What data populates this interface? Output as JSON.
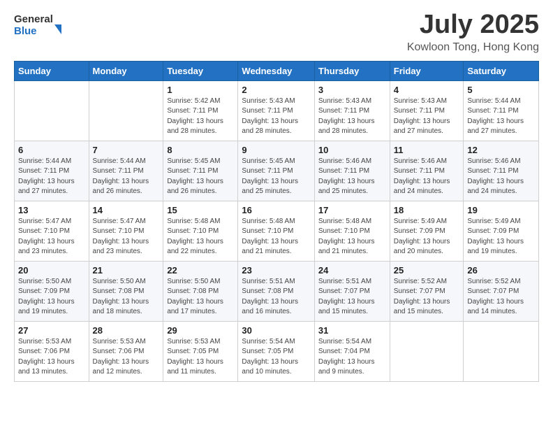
{
  "header": {
    "logo_line1": "General",
    "logo_line2": "Blue",
    "month": "July 2025",
    "location": "Kowloon Tong, Hong Kong"
  },
  "days_of_week": [
    "Sunday",
    "Monday",
    "Tuesday",
    "Wednesday",
    "Thursday",
    "Friday",
    "Saturday"
  ],
  "weeks": [
    [
      {
        "day": "",
        "sunrise": "",
        "sunset": "",
        "daylight": ""
      },
      {
        "day": "",
        "sunrise": "",
        "sunset": "",
        "daylight": ""
      },
      {
        "day": "1",
        "sunrise": "Sunrise: 5:42 AM",
        "sunset": "Sunset: 7:11 PM",
        "daylight": "Daylight: 13 hours and 28 minutes."
      },
      {
        "day": "2",
        "sunrise": "Sunrise: 5:43 AM",
        "sunset": "Sunset: 7:11 PM",
        "daylight": "Daylight: 13 hours and 28 minutes."
      },
      {
        "day": "3",
        "sunrise": "Sunrise: 5:43 AM",
        "sunset": "Sunset: 7:11 PM",
        "daylight": "Daylight: 13 hours and 28 minutes."
      },
      {
        "day": "4",
        "sunrise": "Sunrise: 5:43 AM",
        "sunset": "Sunset: 7:11 PM",
        "daylight": "Daylight: 13 hours and 27 minutes."
      },
      {
        "day": "5",
        "sunrise": "Sunrise: 5:44 AM",
        "sunset": "Sunset: 7:11 PM",
        "daylight": "Daylight: 13 hours and 27 minutes."
      }
    ],
    [
      {
        "day": "6",
        "sunrise": "Sunrise: 5:44 AM",
        "sunset": "Sunset: 7:11 PM",
        "daylight": "Daylight: 13 hours and 27 minutes."
      },
      {
        "day": "7",
        "sunrise": "Sunrise: 5:44 AM",
        "sunset": "Sunset: 7:11 PM",
        "daylight": "Daylight: 13 hours and 26 minutes."
      },
      {
        "day": "8",
        "sunrise": "Sunrise: 5:45 AM",
        "sunset": "Sunset: 7:11 PM",
        "daylight": "Daylight: 13 hours and 26 minutes."
      },
      {
        "day": "9",
        "sunrise": "Sunrise: 5:45 AM",
        "sunset": "Sunset: 7:11 PM",
        "daylight": "Daylight: 13 hours and 25 minutes."
      },
      {
        "day": "10",
        "sunrise": "Sunrise: 5:46 AM",
        "sunset": "Sunset: 7:11 PM",
        "daylight": "Daylight: 13 hours and 25 minutes."
      },
      {
        "day": "11",
        "sunrise": "Sunrise: 5:46 AM",
        "sunset": "Sunset: 7:11 PM",
        "daylight": "Daylight: 13 hours and 24 minutes."
      },
      {
        "day": "12",
        "sunrise": "Sunrise: 5:46 AM",
        "sunset": "Sunset: 7:11 PM",
        "daylight": "Daylight: 13 hours and 24 minutes."
      }
    ],
    [
      {
        "day": "13",
        "sunrise": "Sunrise: 5:47 AM",
        "sunset": "Sunset: 7:10 PM",
        "daylight": "Daylight: 13 hours and 23 minutes."
      },
      {
        "day": "14",
        "sunrise": "Sunrise: 5:47 AM",
        "sunset": "Sunset: 7:10 PM",
        "daylight": "Daylight: 13 hours and 23 minutes."
      },
      {
        "day": "15",
        "sunrise": "Sunrise: 5:48 AM",
        "sunset": "Sunset: 7:10 PM",
        "daylight": "Daylight: 13 hours and 22 minutes."
      },
      {
        "day": "16",
        "sunrise": "Sunrise: 5:48 AM",
        "sunset": "Sunset: 7:10 PM",
        "daylight": "Daylight: 13 hours and 21 minutes."
      },
      {
        "day": "17",
        "sunrise": "Sunrise: 5:48 AM",
        "sunset": "Sunset: 7:10 PM",
        "daylight": "Daylight: 13 hours and 21 minutes."
      },
      {
        "day": "18",
        "sunrise": "Sunrise: 5:49 AM",
        "sunset": "Sunset: 7:09 PM",
        "daylight": "Daylight: 13 hours and 20 minutes."
      },
      {
        "day": "19",
        "sunrise": "Sunrise: 5:49 AM",
        "sunset": "Sunset: 7:09 PM",
        "daylight": "Daylight: 13 hours and 19 minutes."
      }
    ],
    [
      {
        "day": "20",
        "sunrise": "Sunrise: 5:50 AM",
        "sunset": "Sunset: 7:09 PM",
        "daylight": "Daylight: 13 hours and 19 minutes."
      },
      {
        "day": "21",
        "sunrise": "Sunrise: 5:50 AM",
        "sunset": "Sunset: 7:08 PM",
        "daylight": "Daylight: 13 hours and 18 minutes."
      },
      {
        "day": "22",
        "sunrise": "Sunrise: 5:50 AM",
        "sunset": "Sunset: 7:08 PM",
        "daylight": "Daylight: 13 hours and 17 minutes."
      },
      {
        "day": "23",
        "sunrise": "Sunrise: 5:51 AM",
        "sunset": "Sunset: 7:08 PM",
        "daylight": "Daylight: 13 hours and 16 minutes."
      },
      {
        "day": "24",
        "sunrise": "Sunrise: 5:51 AM",
        "sunset": "Sunset: 7:07 PM",
        "daylight": "Daylight: 13 hours and 15 minutes."
      },
      {
        "day": "25",
        "sunrise": "Sunrise: 5:52 AM",
        "sunset": "Sunset: 7:07 PM",
        "daylight": "Daylight: 13 hours and 15 minutes."
      },
      {
        "day": "26",
        "sunrise": "Sunrise: 5:52 AM",
        "sunset": "Sunset: 7:07 PM",
        "daylight": "Daylight: 13 hours and 14 minutes."
      }
    ],
    [
      {
        "day": "27",
        "sunrise": "Sunrise: 5:53 AM",
        "sunset": "Sunset: 7:06 PM",
        "daylight": "Daylight: 13 hours and 13 minutes."
      },
      {
        "day": "28",
        "sunrise": "Sunrise: 5:53 AM",
        "sunset": "Sunset: 7:06 PM",
        "daylight": "Daylight: 13 hours and 12 minutes."
      },
      {
        "day": "29",
        "sunrise": "Sunrise: 5:53 AM",
        "sunset": "Sunset: 7:05 PM",
        "daylight": "Daylight: 13 hours and 11 minutes."
      },
      {
        "day": "30",
        "sunrise": "Sunrise: 5:54 AM",
        "sunset": "Sunset: 7:05 PM",
        "daylight": "Daylight: 13 hours and 10 minutes."
      },
      {
        "day": "31",
        "sunrise": "Sunrise: 5:54 AM",
        "sunset": "Sunset: 7:04 PM",
        "daylight": "Daylight: 13 hours and 9 minutes."
      },
      {
        "day": "",
        "sunrise": "",
        "sunset": "",
        "daylight": ""
      },
      {
        "day": "",
        "sunrise": "",
        "sunset": "",
        "daylight": ""
      }
    ]
  ]
}
